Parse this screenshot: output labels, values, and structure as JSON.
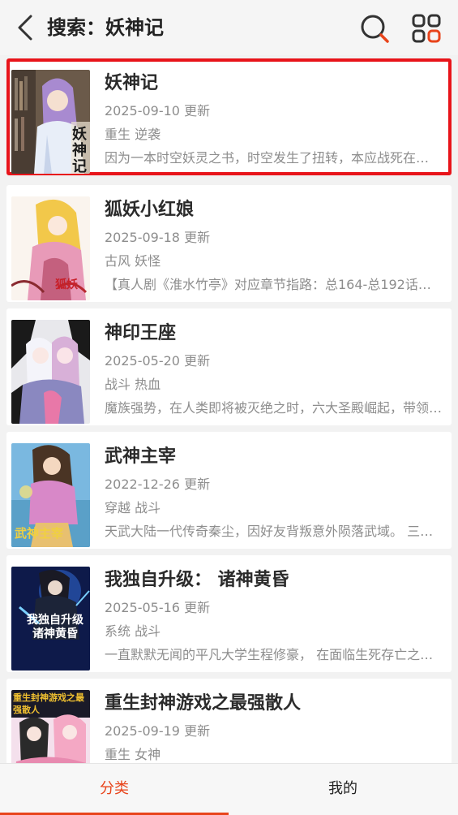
{
  "header": {
    "title": "搜索：妖神记",
    "back_icon": "back-arrow-icon",
    "search_icon": "search-icon",
    "apps_icon": "apps-grid-icon",
    "accent_color": "#e8441b"
  },
  "results": [
    {
      "title": "妖神记",
      "date": "2025-09-10 更新",
      "tags": "重生 逆袭",
      "desc": "因为一本时空妖灵之书，时空发生了扭转，本应战死在神…",
      "cover_text": "妖神记",
      "selected": true
    },
    {
      "title": "狐妖小红娘",
      "date": "2025-09-18 更新",
      "tags": "古风 妖怪",
      "desc": "【真人剧《淮水竹亭》对应章节指路：总164-总192话】 …",
      "cover_text": "狐妖",
      "selected": false
    },
    {
      "title": "神印王座",
      "date": "2025-05-20 更新",
      "tags": "战斗 热血",
      "desc": "魔族强势，在人类即将被灭绝之时，六大圣殿崛起，带领…",
      "cover_text": "",
      "selected": false
    },
    {
      "title": "武神主宰",
      "date": "2022-12-26 更新",
      "tags": "穿越 战斗",
      "desc": "天武大陆一代传奇秦尘，因好友背叛意外陨落武域。 三百…",
      "cover_text": "武神主宰",
      "selected": false
    },
    {
      "title": "我独自升级： 诸神黄昏",
      "date": "2025-05-16 更新",
      "tags": "系统 战斗",
      "desc": "一直默默无闻的平凡大学生程修豪， 在面临生死存亡之际…",
      "cover_text": "我独自升级 诸神黄昏",
      "selected": false
    },
    {
      "title": "重生封神游戏之最强散人",
      "date": "2025-09-19 更新",
      "tags": "重生 女神",
      "desc": "",
      "cover_text": "重生封神游戏之最强散人",
      "selected": false
    }
  ],
  "tabs": [
    {
      "label": "分类",
      "active": true
    },
    {
      "label": "我的",
      "active": false
    }
  ]
}
